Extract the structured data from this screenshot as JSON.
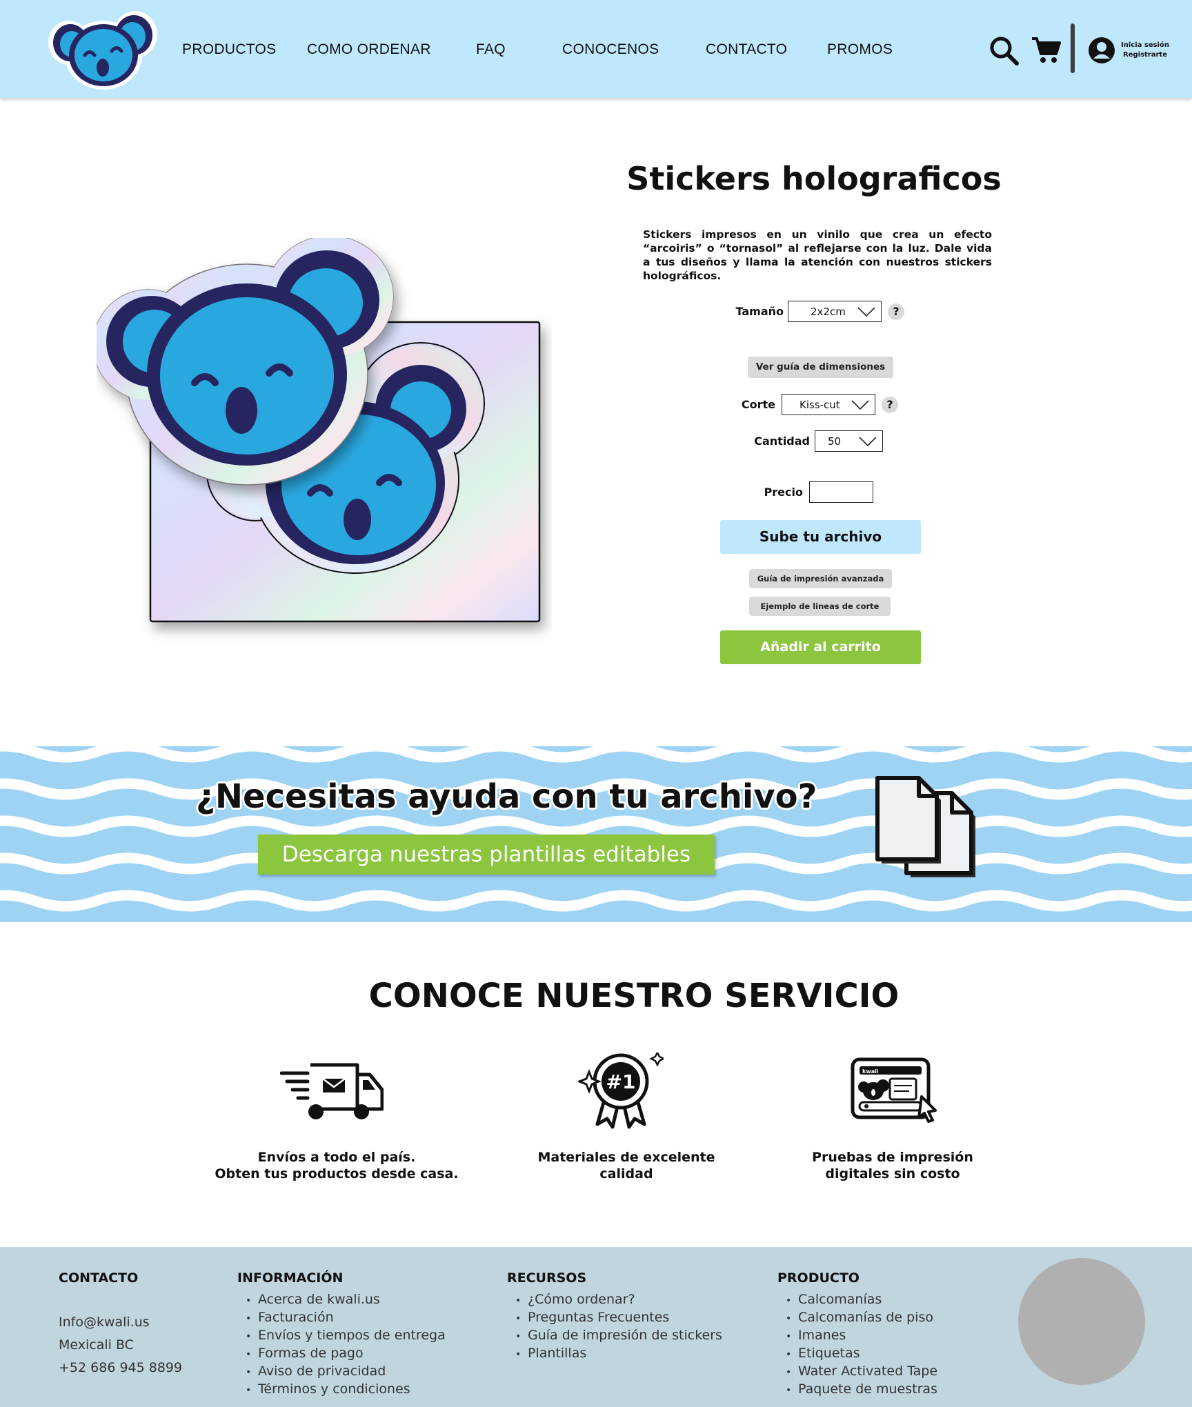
{
  "header": {
    "nav": [
      "PRODUCTOS",
      "COMO ORDENAR",
      "FAQ",
      "CONOCENOS",
      "CONTACTO",
      "PROMOS"
    ],
    "login_line1": "Inicia sesión",
    "login_line2": "Registrarte",
    "icons": [
      "koala-logo",
      "search-icon",
      "cart-icon",
      "user-icon"
    ]
  },
  "product": {
    "title": "Stickers holograficos",
    "description": "Stickers impresos en un vinilo que crea un efecto “arcoiris” o “tornasol” al reflejarse con la luz. Dale vida a tus diseños y llama la atención con nuestros stickers holográficos.",
    "size_label": "Tamaño",
    "size_value": "2x2cm",
    "help_glyph": "?",
    "dimensions_guide": "Ver guía de dimensiones",
    "cut_label": "Corte",
    "cut_value": "Kiss-cut",
    "quantity_label": "Cantidad",
    "quantity_value": "50",
    "price_label": "Precio",
    "price_value": "",
    "upload_button": "Sube tu archivo",
    "advanced_guide": "Guía de impresión avanzada",
    "cut_lines_example": "Ejemplo de lineas de corte",
    "add_to_cart": "Añadir al carrito"
  },
  "banner": {
    "title": "¿Necesitas ayuda con tu archivo?",
    "button": "Descarga nuestras plantillas editables",
    "colors": {
      "wave_blue": "#9fd3f4",
      "wave_white": "#ffffff"
    }
  },
  "service": {
    "title": "CONOCE NUESTRO SERVICIO",
    "items": [
      {
        "line1": "Envíos a todo el país.",
        "line2": "Obten tus productos desde casa.",
        "icon": "delivery-truck-icon"
      },
      {
        "line1": "Materiales de excelente",
        "line2": "calidad",
        "icon": "award-badge-icon",
        "badge_text": "#1"
      },
      {
        "line1": "Pruebas de impresión",
        "line2": "digitales sin costo",
        "icon": "digital-proof-icon",
        "screen_label": "kwali"
      }
    ]
  },
  "footer": {
    "contact": {
      "heading": "CONTACTO",
      "email": "Info@kwali.us",
      "city": "Mexicali BC",
      "phone": "+52 686 945 8899"
    },
    "info": {
      "heading": "INFORMACIÓN",
      "items": [
        "Acerca de kwali.us",
        "Facturación",
        "Envíos y tiempos de entrega",
        "Formas de pago",
        "Aviso de privacidad",
        "Términos y condiciones"
      ]
    },
    "resources": {
      "heading": "RECURSOS",
      "items": [
        "¿Cómo ordenar?",
        "Preguntas Frecuentes",
        "Guía de impresión de stickers",
        "Plantillas"
      ]
    },
    "product": {
      "heading": "PRODUCTO",
      "items": [
        "Calcomanías",
        "Calcomanías de piso",
        "Imanes",
        "Etiquetas",
        "Water Activated Tape",
        "Paquete de muestras"
      ]
    }
  },
  "colors": {
    "header_bg": "#bfe8fd",
    "green": "#8cc63f",
    "footer_bg": "#c0d5de",
    "koala_blue": "#29a8e0",
    "koala_navy": "#262560"
  }
}
